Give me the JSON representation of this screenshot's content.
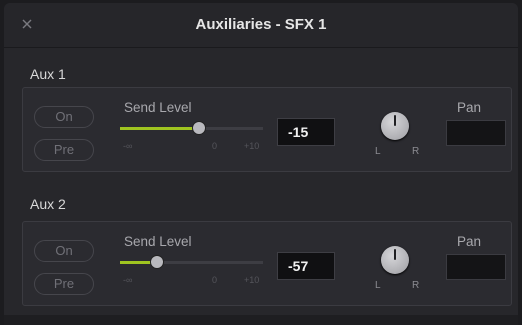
{
  "window": {
    "title": "Auxiliaries - SFX 1",
    "close_icon": "close-icon"
  },
  "aux_sections": [
    {
      "title": "Aux 1",
      "on_label": "On",
      "pre_label": "Pre",
      "send_level_label": "Send Level",
      "slider_min_label": "-∞",
      "slider_mid_label": "0",
      "slider_max_label": "+10",
      "slider_level": 0.55,
      "value": "-15",
      "pan_label": "Pan",
      "pan_left_label": "L",
      "pan_right_label": "R",
      "pan_value": ""
    },
    {
      "title": "Aux 2",
      "on_label": "On",
      "pre_label": "Pre",
      "send_level_label": "Send Level",
      "slider_min_label": "-∞",
      "slider_mid_label": "0",
      "slider_max_label": "+10",
      "slider_level": 0.26,
      "value": "-57",
      "pan_label": "Pan",
      "pan_left_label": "L",
      "pan_right_label": "R",
      "pan_value": ""
    }
  ],
  "colors": {
    "accent": "#9fc420",
    "background": "#27272b",
    "panel": "#2b2b30"
  }
}
